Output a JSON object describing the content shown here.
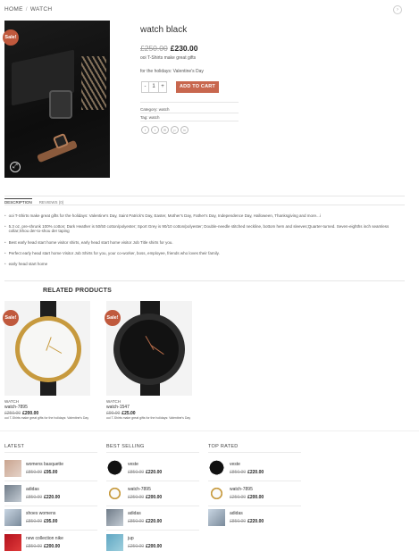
{
  "breadcrumb": {
    "home": "HOME",
    "sep": "/",
    "current": "WATCH"
  },
  "product": {
    "sale_badge": "Sale!",
    "title": "watch black",
    "old_price": "£250.00",
    "price": "£230.00",
    "desc_line1": "ooi T-Shirts make great gifts",
    "desc_line2": "for the holidays: Valentine's Day",
    "qty_minus": "-",
    "qty_value": "1",
    "qty_plus": "+",
    "add_to_cart": "ADD TO CART",
    "category_label": "Category:",
    "category_value": "watch",
    "tag_label": "Tag:",
    "tag_value": "watch"
  },
  "share_icons": [
    "facebook-icon",
    "twitter-icon",
    "email-icon",
    "pinterest-icon",
    "linkedin-icon"
  ],
  "tabs": {
    "description": "DESCRIPTION",
    "reviews": "REVIEWS (0)"
  },
  "description_bullets": [
    "ooi T-Shirts make great gifts for the holidays: Valentine's Day, Saint Patrick's Day, Easter, Mother's Day, Father's Day, Independence Day, Halloween, Thanksgiving and more...i",
    "5.3 oz, pre-shrunk 100% cotton; Dark Heather is 50/50 cotton/polyester; Sport Grey is 90/10 cotton/polyester; Double-needle stitched neckline, bottom hem and sleeves;Quarter-turned. Seven-eighths inch seamless collar;Shou der-to-shou der taping",
    "Best early head start home visitor shirts, early head start home visitor Job Title shirts for you.",
    "Perfect early head start home Visitor Job Shirts for you, your co-worker, boss, employee, friends who loves their family.",
    "early head start home"
  ],
  "related": {
    "title": "RELATED PRODUCTS",
    "items": [
      {
        "sale": "Sale!",
        "category": "WATCH",
        "name": "watch-7895",
        "old_price": "£250.00",
        "price": "£200.00",
        "desc": "ooi T-Shirts make great gifts for the holidays: Valentine's Day"
      },
      {
        "sale": "Sale!",
        "category": "WATCH",
        "name": "watch-1547",
        "old_price": "£90.00",
        "price": "£25.00",
        "desc": "ooi T-Shirts make great gifts for the holidays: Valentine's Day"
      }
    ]
  },
  "footer": {
    "latest": {
      "title": "LATEST",
      "items": [
        {
          "name": "womens basquette",
          "old_price": "£850.00",
          "price": "£95.00"
        },
        {
          "name": "adidas",
          "old_price": "£850.00",
          "price": "£220.00"
        },
        {
          "name": "shoes womens",
          "old_price": "£850.00",
          "price": "£95.00"
        },
        {
          "name": "new collection nike",
          "old_price": "£850.00",
          "price": "£200.00"
        }
      ]
    },
    "best_selling": {
      "title": "BEST SELLING",
      "items": [
        {
          "name": "veste",
          "old_price": "£850.00",
          "price": "£220.00"
        },
        {
          "name": "watch-7895",
          "old_price": "£250.00",
          "price": "£200.00"
        },
        {
          "name": "adidas",
          "old_price": "£850.00",
          "price": "£220.00"
        },
        {
          "name": "jup",
          "old_price": "£250.00",
          "price": "£200.00"
        }
      ]
    },
    "top_rated": {
      "title": "TOP RATED",
      "items": [
        {
          "name": "veste",
          "old_price": "£850.00",
          "price": "£220.00"
        },
        {
          "name": "watch-7895",
          "old_price": "£250.00",
          "price": "£200.00"
        },
        {
          "name": "adidas",
          "old_price": "£850.00",
          "price": "£220.00"
        }
      ]
    }
  },
  "colors": {
    "accent": "#c8674e",
    "sale": "#c0593d"
  }
}
